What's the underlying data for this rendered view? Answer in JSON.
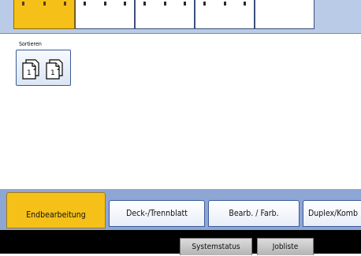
{
  "section": {
    "label": "Sortieren"
  },
  "tabs": [
    {
      "label": "Endbearbeitung",
      "active": true
    },
    {
      "label": "Deck-/Trennblatt",
      "active": false
    },
    {
      "label": "Bearb. / Farb.",
      "active": false
    },
    {
      "label": "Duplex/Komb",
      "active": false
    }
  ],
  "footer": {
    "status_label": "Systemstatus",
    "joblist_label": "Jobliste"
  },
  "colors": {
    "active_accent": "#f5c118",
    "tab_bar": "#8da6d4",
    "top_strip": "#b9cbe6"
  },
  "icons": {
    "sort": "sort-collate-icon"
  }
}
